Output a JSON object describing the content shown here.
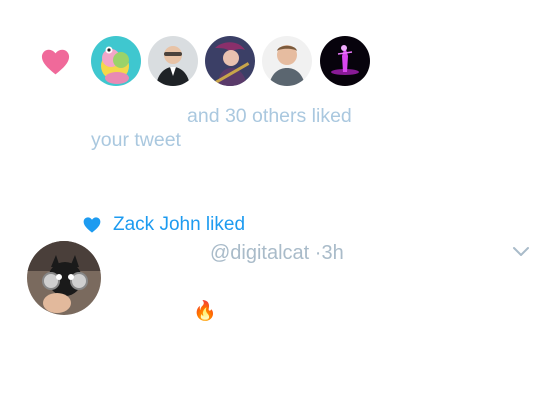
{
  "likes_notification": {
    "icon": "heart-icon",
    "icon_color": "#f0699a",
    "avatars": [
      "avatar-1",
      "avatar-2",
      "avatar-3",
      "avatar-4",
      "avatar-5"
    ],
    "summary_text": "and 30 others liked your tweet"
  },
  "liked_tweet": {
    "icon": "heart-icon",
    "icon_color": "#1d9bf0",
    "liked_by": "Zack John liked",
    "handle_time": "@digitalcat ·3h",
    "menu_icon": "chevron-down-icon",
    "content_emoji": "🔥"
  }
}
